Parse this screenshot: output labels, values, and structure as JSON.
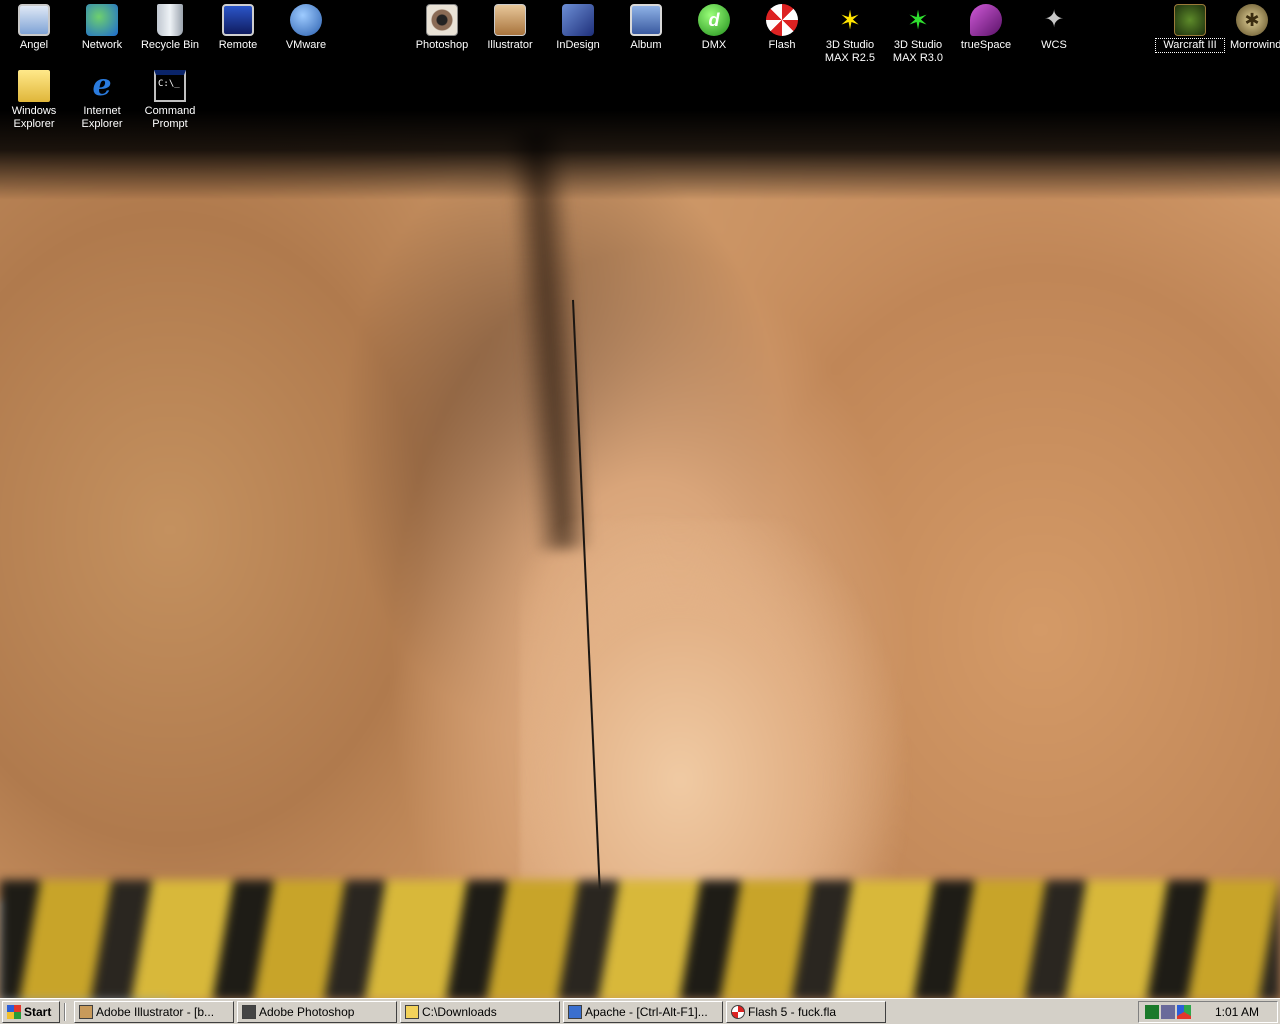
{
  "desktop": {
    "icons": [
      {
        "label": "Angel"
      },
      {
        "label": "Network"
      },
      {
        "label": "Recycle Bin"
      },
      {
        "label": "Remote"
      },
      {
        "label": "VMware"
      },
      {
        "label": "Photoshop"
      },
      {
        "label": "Illustrator"
      },
      {
        "label": "InDesign"
      },
      {
        "label": "Album"
      },
      {
        "label": "DMX"
      },
      {
        "label": "Flash"
      },
      {
        "label": "3D Studio MAX R2.5"
      },
      {
        "label": "3D Studio MAX R3.0"
      },
      {
        "label": "trueSpace"
      },
      {
        "label": "WCS"
      },
      {
        "label": "Warcraft III"
      },
      {
        "label": "Morrowind"
      },
      {
        "label": "Windows Explorer"
      },
      {
        "label": "Internet Explorer"
      },
      {
        "label": "Command Prompt"
      }
    ]
  },
  "taskbar": {
    "start_label": "Start",
    "tasks": [
      {
        "label": "Adobe Illustrator - [b..."
      },
      {
        "label": "Adobe Photoshop"
      },
      {
        "label": "C:\\Downloads"
      },
      {
        "label": "Apache - [Ctrl-Alt-F1]..."
      },
      {
        "label": "Flash 5 - fuck.fla"
      }
    ],
    "clock": "1:01 AM"
  },
  "icon_glyphs": {
    "command_prompt": "C:\\_"
  }
}
